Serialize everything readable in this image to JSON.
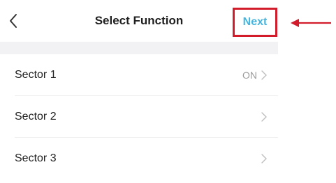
{
  "header": {
    "title": "Select Function",
    "back_icon": "chevron-left-icon",
    "next_label": "Next"
  },
  "sectors": [
    {
      "label": "Sector 1",
      "value": "ON"
    },
    {
      "label": "Sector 2",
      "value": ""
    },
    {
      "label": "Sector 3",
      "value": ""
    }
  ],
  "colors": {
    "accent": "#45b6e0",
    "highlight": "#d21c2b",
    "title_text": "#1f1f1f",
    "secondary_text": "#9b9b9b",
    "background_gap": "#f2f2f4"
  },
  "annotation": {
    "arrow_icon": "arrow-left-icon"
  }
}
